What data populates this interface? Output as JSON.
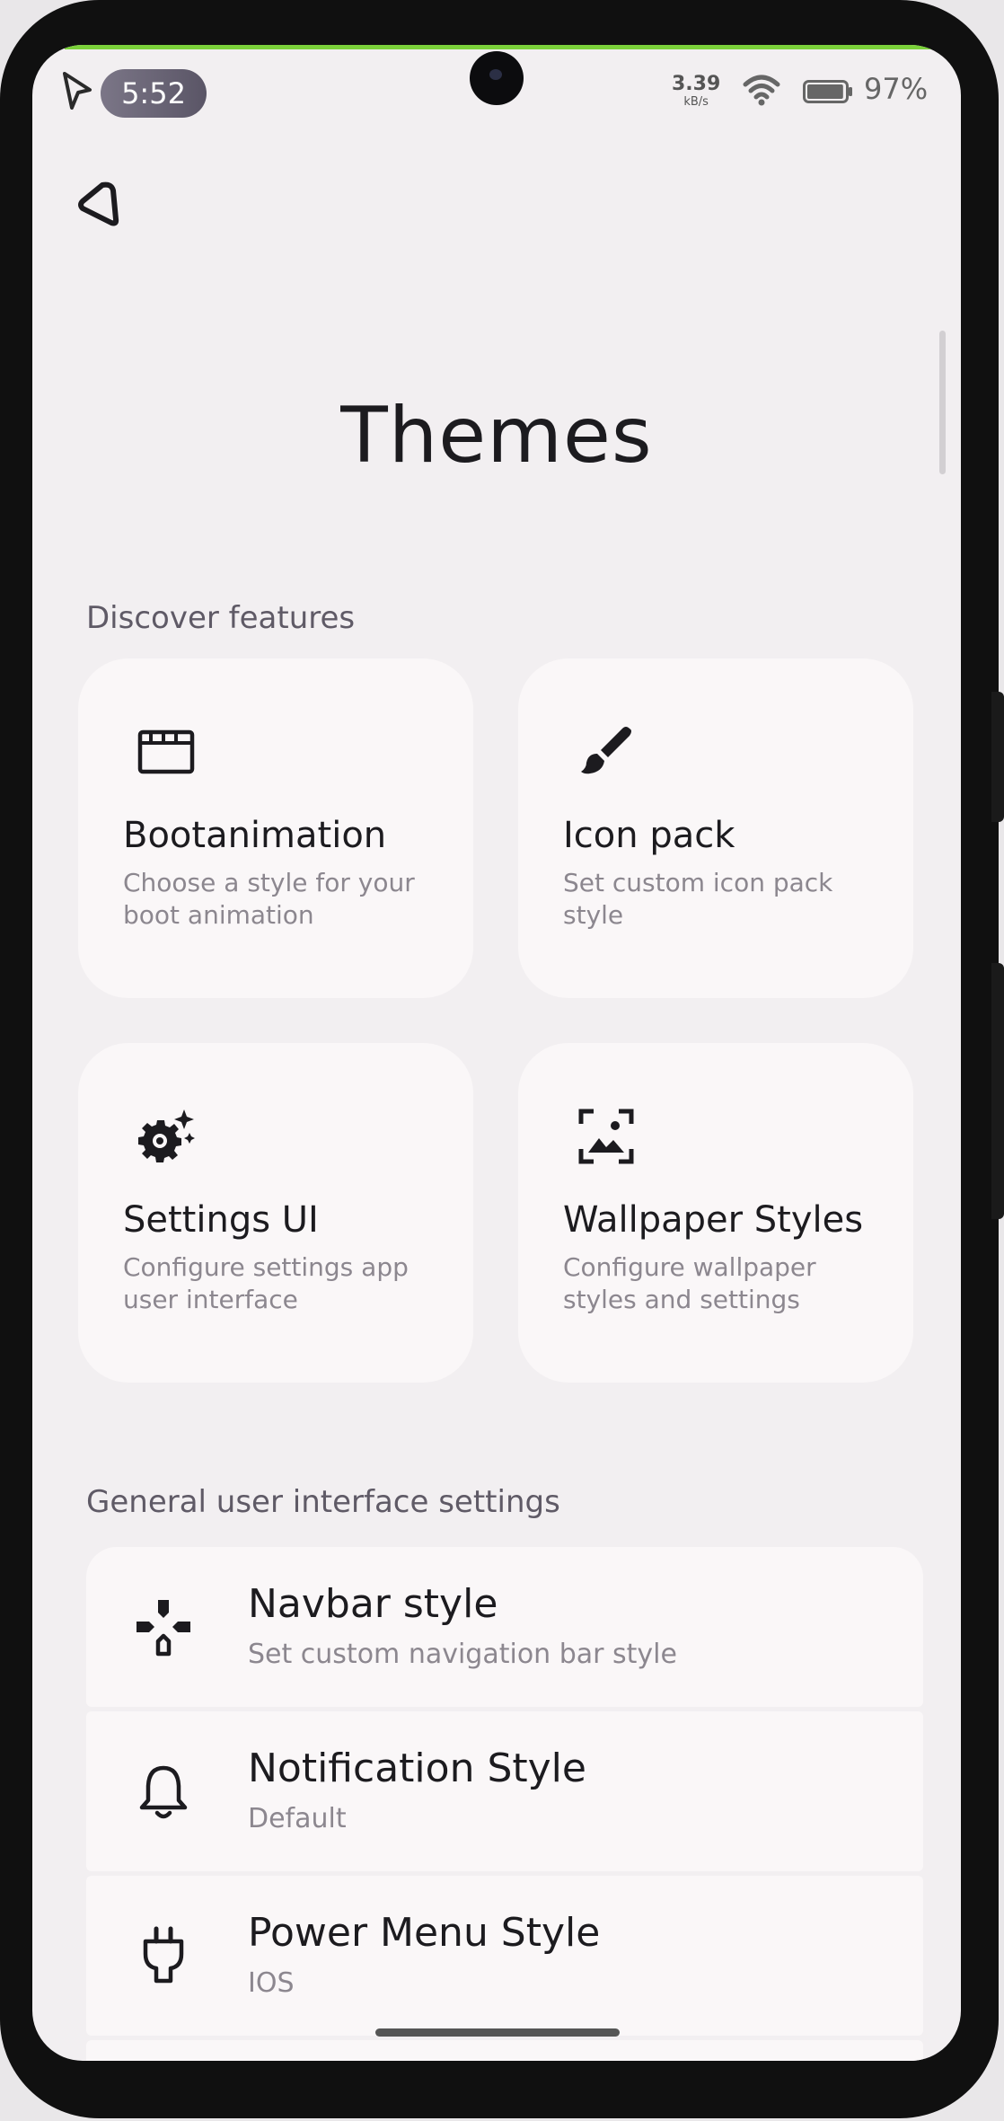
{
  "status_bar": {
    "time": "5:52",
    "net_speed_value": "3.39",
    "net_speed_unit": "kB/s",
    "wifi_icon": "wifi-icon",
    "battery_percent": "97%",
    "battery_level": 0.97
  },
  "header": {
    "back_icon": "back-arrow-icon",
    "title": "Themes"
  },
  "discover": {
    "section_label": "Discover features",
    "cards": [
      {
        "title": "Bootanimation",
        "subtitle": "Choose a style for your boot animation",
        "icon": "clapperboard-icon"
      },
      {
        "title": "Icon pack",
        "subtitle": "Set custom icon pack style",
        "icon": "paintbrush-icon"
      },
      {
        "title": "Settings UI",
        "subtitle": "Configure settings app user interface",
        "icon": "gear-sparkle-icon"
      },
      {
        "title": "Wallpaper Styles",
        "subtitle": "Configure wallpaper styles and settings",
        "icon": "wallpaper-icon"
      }
    ]
  },
  "general": {
    "section_label": "General user interface settings",
    "items": [
      {
        "title": "Navbar style",
        "subtitle": "Set custom navigation bar style",
        "icon": "gamepad-icon"
      },
      {
        "title": "Notification Style",
        "subtitle": "Default",
        "icon": "bell-icon"
      },
      {
        "title": "Power Menu Style",
        "subtitle": "IOS",
        "icon": "plug-icon"
      }
    ]
  }
}
